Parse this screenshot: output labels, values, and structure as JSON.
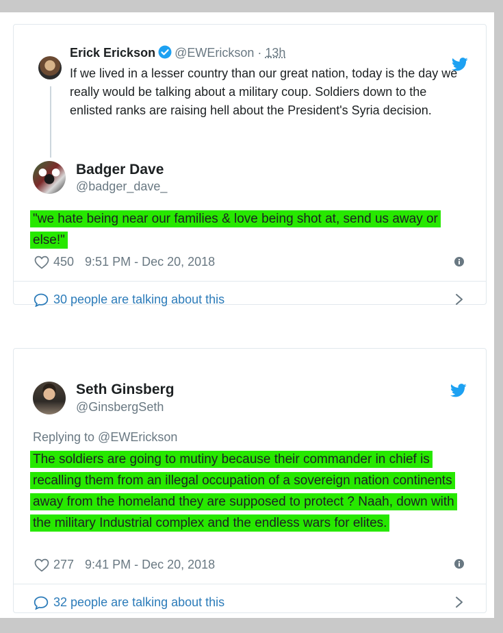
{
  "tweet1": {
    "quoted": {
      "author_name": "Erick Erickson",
      "author_handle": "@EWErickson",
      "separator": "·",
      "time_ago": "13h",
      "text": "If we lived in a lesser country than our great nation, today is the day we really would be talking about a military coup.  Soldiers down to the enlisted ranks are raising hell about the President's Syria decision."
    },
    "author_name": "Badger Dave",
    "author_handle": "@badger_dave_",
    "text": "\"we hate being near our families & love being shot at, send us away or else!\"",
    "likes": "450",
    "timestamp": "9:51 PM - Dec 20, 2018",
    "talking": "30 people are talking about this"
  },
  "tweet2": {
    "author_name": "Seth Ginsberg",
    "author_handle": "@GinsbergSeth",
    "replying_to": "Replying to @EWErickson",
    "text": "The soldiers are going to mutiny because their commander in chief is recalling them from an illegal occupation of a sovereign nation continents away from the homeland they are supposed to protect ? Naah, down with the military Industrial complex and the endless wars for elites.",
    "likes": "277",
    "timestamp": "9:41 PM - Dec 20, 2018",
    "talking": "32 people are talking about this"
  },
  "colors": {
    "highlight": "#27e800",
    "link": "#2b7bb9",
    "twitter_blue": "#1da1f2",
    "muted": "#697882"
  }
}
